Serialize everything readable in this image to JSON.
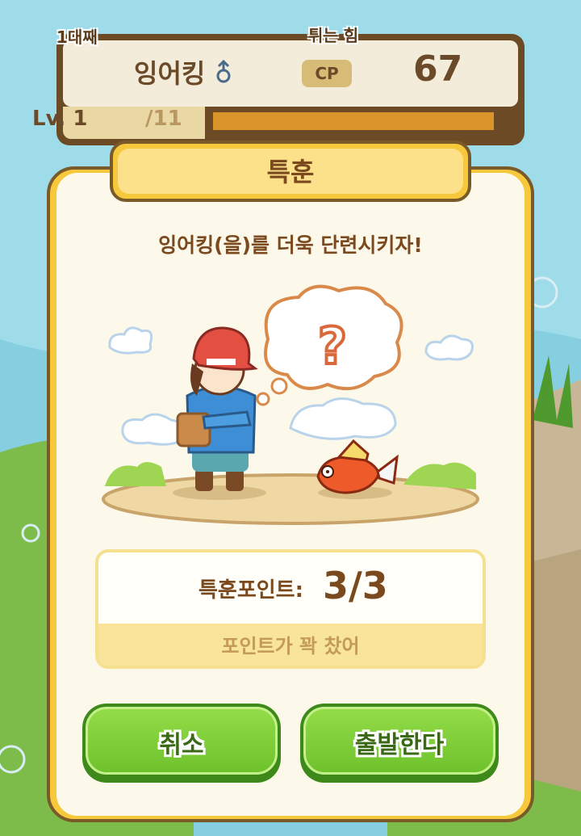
{
  "header": {
    "generation": "1대째",
    "trait": "튀는 힘",
    "pokemon_name": "잉어킹",
    "cp_label": "CP",
    "cp_value": "67",
    "level_label": "Lv. 1",
    "level_max": "/11",
    "xp_progress": 1.0
  },
  "dialog": {
    "title": "특훈",
    "message": "잉어킹(을)를 더욱 단련시키자!",
    "thought_symbol": "?",
    "points_label": "특훈포인트:",
    "points_value": "3/3",
    "points_note": "포인트가 꽉 찼어",
    "cancel_label": "취소",
    "go_label": "출발한다"
  },
  "colors": {
    "accent_yellow": "#f6c93c",
    "button_green": "#7dcc38",
    "text_brown": "#7a4a1e"
  },
  "icons": {
    "gender": "male-icon",
    "trainer": "trainer-character",
    "pokemon": "magikarp-sprite",
    "thought": "thought-bubble-icon"
  }
}
